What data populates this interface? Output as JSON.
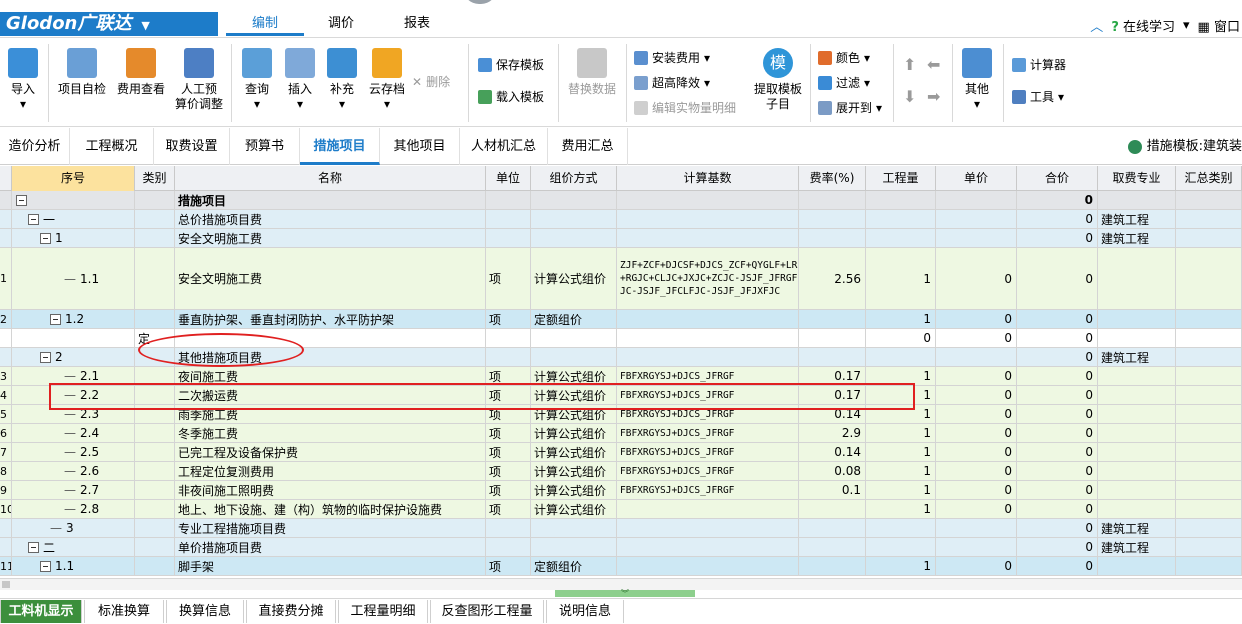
{
  "app": {
    "logo": "Glodon广联达",
    "menu": [
      "编制",
      "调价",
      "报表"
    ],
    "online_learning": "在线学习",
    "window": "窗口"
  },
  "ribbon": {
    "import": "导入",
    "self_check": "项目自检",
    "fee_check": "费用查看",
    "labor_prep_1": "人工预",
    "labor_prep_2": "算价调整",
    "query": "查询",
    "insert": "插入",
    "supplement": "补充",
    "cloud_archive": "云存档",
    "delete": "删除",
    "save_template": "保存模板",
    "load_template": "载入模板",
    "replace_data": "替换数据",
    "install_fee": "安装费用",
    "high_rise_reduce": "超高降效",
    "edit_entity_qty": "编辑实物量明细",
    "mo_icon": "模",
    "extract_template_1": "提取模板",
    "extract_template_2": "子目",
    "color": "颜色",
    "filter": "过滤",
    "expand_to": "展开到",
    "other": "其他",
    "calculator": "计算器",
    "tools": "工具"
  },
  "tabs": [
    "造价分析",
    "工程概况",
    "取费设置",
    "预算书",
    "措施项目",
    "其他项目",
    "人材机汇总",
    "费用汇总"
  ],
  "active_tab": "措施项目",
  "template_label": "措施模板:建筑装",
  "table": {
    "headers": [
      "序号",
      "类别",
      "名称",
      "单位",
      "组价方式",
      "计算基数",
      "费率(%)",
      "工程量",
      "单价",
      "合价",
      "取费专业",
      "汇总类别"
    ],
    "rows": [
      {
        "rn": "",
        "seq": "",
        "cat": "",
        "name": "措施项目",
        "unit": "",
        "method": "",
        "base": "",
        "rate": "",
        "qty": "",
        "price": "",
        "total": "0",
        "prof": "",
        "bold": true,
        "bg": "#e3e5e8"
      },
      {
        "rn": "",
        "seq": "一",
        "cat": "",
        "name": "总价措施项目费",
        "unit": "",
        "method": "",
        "base": "",
        "rate": "",
        "qty": "",
        "price": "",
        "total": "0",
        "prof": "建筑工程",
        "bg": "#dfeef6"
      },
      {
        "rn": "",
        "seq": "1",
        "cat": "",
        "name": "安全文明施工费",
        "unit": "",
        "method": "",
        "base": "",
        "rate": "",
        "qty": "",
        "price": "",
        "total": "0",
        "prof": "建筑工程",
        "bg": "#dfeef6"
      },
      {
        "rn": "1",
        "seq": "1.1",
        "cat": "",
        "name": "安全文明施工费",
        "unit": "项",
        "method": "计算公式组价",
        "base": "ZJF+ZCF+DJCSF+DJCS_ZCF+QYGLF+LR+RGJC+CLJC+JXJC+ZCJC-JSJF_JFRGFJC-JSJF_JFCLFJC-JSJF_JFJXFJC",
        "rate": "2.56",
        "qty": "1",
        "price": "0",
        "total": "0",
        "prof": "",
        "bg": "#eef8e2",
        "tall": true
      },
      {
        "rn": "2",
        "seq": "1.2",
        "cat": "",
        "name": "垂直防护架、垂直封闭防护、水平防护架",
        "unit": "项",
        "method": "定额组价",
        "base": "",
        "rate": "",
        "qty": "1",
        "price": "0",
        "total": "0",
        "prof": "",
        "bg": "#cde8f4"
      },
      {
        "rn": "",
        "seq": "",
        "cat": "定",
        "name": "",
        "unit": "",
        "method": "",
        "base": "",
        "rate": "",
        "qty": "0",
        "price": "0",
        "total": "0",
        "prof": "",
        "bg": "#ffffff"
      },
      {
        "rn": "",
        "seq": "2",
        "cat": "",
        "name": "其他措施项目费",
        "unit": "",
        "method": "",
        "base": "",
        "rate": "",
        "qty": "",
        "price": "",
        "total": "0",
        "prof": "建筑工程",
        "bg": "#dfeef6"
      },
      {
        "rn": "3",
        "seq": "2.1",
        "cat": "",
        "name": "夜间施工费",
        "unit": "项",
        "method": "计算公式组价",
        "base": "FBFXRGYSJ+DJCS_JFRGF",
        "rate": "0.17",
        "qty": "1",
        "price": "0",
        "total": "0",
        "prof": "",
        "bg": "#eef8e2"
      },
      {
        "rn": "4",
        "seq": "2.2",
        "cat": "",
        "name": "二次搬运费",
        "unit": "项",
        "method": "计算公式组价",
        "base": "FBFXRGYSJ+DJCS_JFRGF",
        "rate": "0.17",
        "qty": "1",
        "price": "0",
        "total": "0",
        "prof": "",
        "bg": "#eef8e2"
      },
      {
        "rn": "5",
        "seq": "2.3",
        "cat": "",
        "name": "雨季施工费",
        "unit": "项",
        "method": "计算公式组价",
        "base": "FBFXRGYSJ+DJCS_JFRGF",
        "rate": "0.14",
        "qty": "1",
        "price": "0",
        "total": "0",
        "prof": "",
        "bg": "#eef8e2"
      },
      {
        "rn": "6",
        "seq": "2.4",
        "cat": "",
        "name": "冬季施工费",
        "unit": "项",
        "method": "计算公式组价",
        "base": "FBFXRGYSJ+DJCS_JFRGF",
        "rate": "2.9",
        "qty": "1",
        "price": "0",
        "total": "0",
        "prof": "",
        "bg": "#eef8e2"
      },
      {
        "rn": "7",
        "seq": "2.5",
        "cat": "",
        "name": "已完工程及设备保护费",
        "unit": "项",
        "method": "计算公式组价",
        "base": "FBFXRGYSJ+DJCS_JFRGF",
        "rate": "0.14",
        "qty": "1",
        "price": "0",
        "total": "0",
        "prof": "",
        "bg": "#eef8e2"
      },
      {
        "rn": "8",
        "seq": "2.6",
        "cat": "",
        "name": "工程定位复测费用",
        "unit": "项",
        "method": "计算公式组价",
        "base": "FBFXRGYSJ+DJCS_JFRGF",
        "rate": "0.08",
        "qty": "1",
        "price": "0",
        "total": "0",
        "prof": "",
        "bg": "#eef8e2"
      },
      {
        "rn": "9",
        "seq": "2.7",
        "cat": "",
        "name": "非夜间施工照明费",
        "unit": "项",
        "method": "计算公式组价",
        "base": "FBFXRGYSJ+DJCS_JFRGF",
        "rate": "0.1",
        "qty": "1",
        "price": "0",
        "total": "0",
        "prof": "",
        "bg": "#eef8e2"
      },
      {
        "rn": "10",
        "seq": "2.8",
        "cat": "",
        "name": "地上、地下设施、建（构）筑物的临时保护设施费",
        "unit": "项",
        "method": "计算公式组价",
        "base": "",
        "rate": "",
        "qty": "1",
        "price": "0",
        "total": "0",
        "prof": "",
        "bg": "#eef8e2"
      },
      {
        "rn": "",
        "seq": "3",
        "cat": "",
        "name": "专业工程措施项目费",
        "unit": "",
        "method": "",
        "base": "",
        "rate": "",
        "qty": "",
        "price": "",
        "total": "0",
        "prof": "建筑工程",
        "bg": "#dfeef6"
      },
      {
        "rn": "",
        "seq": "二",
        "cat": "",
        "name": "单价措施项目费",
        "unit": "",
        "method": "",
        "base": "",
        "rate": "",
        "qty": "",
        "price": "",
        "total": "0",
        "prof": "建筑工程",
        "bg": "#dfeef6"
      },
      {
        "rn": "11",
        "seq": "1.1",
        "cat": "",
        "name": "脚手架",
        "unit": "项",
        "method": "定额组价",
        "base": "",
        "rate": "",
        "qty": "1",
        "price": "0",
        "total": "0",
        "prof": "",
        "bg": "#cde8f4"
      }
    ]
  },
  "bottom_tabs": [
    "工料机显示",
    "标准换算",
    "换算信息",
    "直接费分摊",
    "工程量明细",
    "反查图形工程量",
    "说明信息"
  ],
  "active_bottom_tab": "工料机显示"
}
